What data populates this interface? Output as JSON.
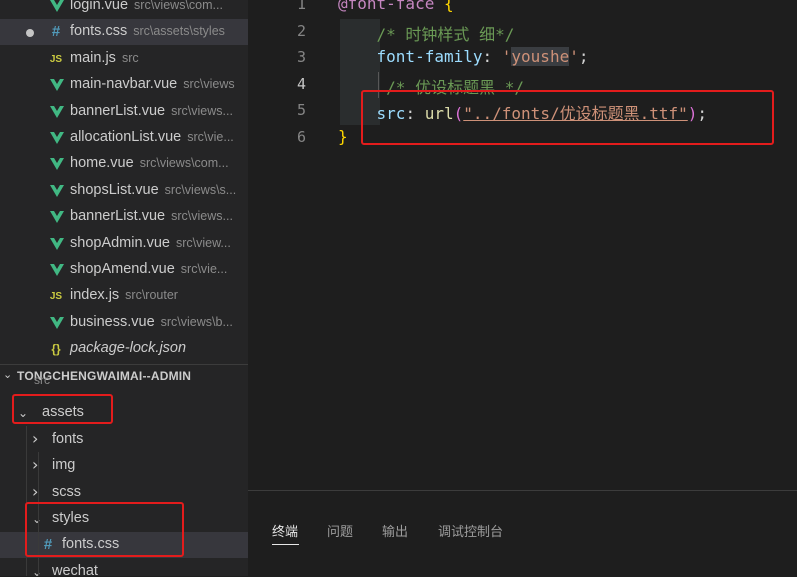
{
  "open_editors": [
    {
      "name": "login.vue",
      "path": "src\\views\\com...",
      "icon": "vue-icon",
      "active": false,
      "dirty": false
    },
    {
      "name": "fonts.css",
      "path": "src\\assets\\styles",
      "icon": "css-icon",
      "active": true,
      "dirty": true
    },
    {
      "name": "main.js",
      "path": "src",
      "icon": "js-icon",
      "active": false,
      "dirty": false
    },
    {
      "name": "main-navbar.vue",
      "path": "src\\views",
      "icon": "vue-icon",
      "active": false,
      "dirty": false
    },
    {
      "name": "bannerList.vue",
      "path": "src\\views...",
      "icon": "vue-icon",
      "active": false,
      "dirty": false
    },
    {
      "name": "allocationList.vue",
      "path": "src\\vie...",
      "icon": "vue-icon",
      "active": false,
      "dirty": false
    },
    {
      "name": "home.vue",
      "path": "src\\views\\com...",
      "icon": "vue-icon",
      "active": false,
      "dirty": false
    },
    {
      "name": "shopsList.vue",
      "path": "src\\views\\s...",
      "icon": "vue-icon",
      "active": false,
      "dirty": false
    },
    {
      "name": "bannerList.vue",
      "path": "src\\views...",
      "icon": "vue-icon",
      "active": false,
      "dirty": false
    },
    {
      "name": "shopAdmin.vue",
      "path": "src\\view...",
      "icon": "vue-icon",
      "active": false,
      "dirty": false
    },
    {
      "name": "shopAmend.vue",
      "path": "src\\vie...",
      "icon": "vue-icon",
      "active": false,
      "dirty": false
    },
    {
      "name": "index.js",
      "path": "src\\router",
      "icon": "js-icon",
      "active": false,
      "dirty": false
    },
    {
      "name": "business.vue",
      "path": "src\\views\\b...",
      "icon": "vue-icon",
      "active": false,
      "dirty": false
    },
    {
      "name": "package-lock.json",
      "path": "",
      "icon": "json-icon",
      "active": false,
      "dirty": false
    }
  ],
  "icons": {
    "js_text": "JS",
    "css_text": "#",
    "json_text": "{}"
  },
  "project": {
    "title": "TONGCHENGWAIMAI--ADMIN",
    "items": [
      {
        "label": "src",
        "chevron": "",
        "level": 0
      },
      {
        "label": "assets",
        "chevron": "open",
        "level": 1
      },
      {
        "label": "fonts",
        "chevron": "closed",
        "level": 2
      },
      {
        "label": "img",
        "chevron": "closed",
        "level": 2
      },
      {
        "label": "scss",
        "chevron": "closed",
        "level": 2
      },
      {
        "label": "styles",
        "chevron": "open",
        "level": 2
      },
      {
        "label": "fonts.css",
        "chevron": "",
        "level": 3,
        "icon": "css-icon",
        "active": true
      },
      {
        "label": "wechat",
        "chevron": "open",
        "level": 2
      }
    ]
  },
  "editor": {
    "current_line": "4",
    "lines": [
      {
        "n": "1",
        "tokens": [
          {
            "t": "@font-face",
            "c": "tok-at"
          },
          {
            "t": " ",
            "c": "tok-punc"
          },
          {
            "t": "{",
            "c": "tok-brace"
          }
        ]
      },
      {
        "n": "2",
        "tokens": [
          {
            "t": "    ",
            "c": "tok-punc"
          },
          {
            "t": "/* 时钟样式 细*/",
            "c": "tok-comment"
          }
        ]
      },
      {
        "n": "3",
        "tokens": [
          {
            "t": "    ",
            "c": "tok-punc"
          },
          {
            "t": "font-family",
            "c": "tok-prop"
          },
          {
            "t": ": ",
            "c": "tok-punc"
          },
          {
            "t": "'",
            "c": "tok-str"
          },
          {
            "t": "youshe",
            "c": "tok-str hl-word"
          },
          {
            "t": "'",
            "c": "tok-str"
          },
          {
            "t": ";",
            "c": "tok-punc"
          }
        ]
      },
      {
        "n": "4",
        "tokens": [
          {
            "t": "     ",
            "c": "tok-punc"
          },
          {
            "t": "/* 优设标题黑 */",
            "c": "tok-comment"
          }
        ]
      },
      {
        "n": "5",
        "tokens": [
          {
            "t": "    ",
            "c": "tok-punc"
          },
          {
            "t": "src",
            "c": "tok-prop"
          },
          {
            "t": ": ",
            "c": "tok-punc"
          },
          {
            "t": "url",
            "c": "tok-fn"
          },
          {
            "t": "(",
            "c": "tok-paren"
          },
          {
            "t": "\"../fonts/优设标题黑.ttf\"",
            "c": "tok-str underline"
          },
          {
            "t": ")",
            "c": "tok-paren"
          },
          {
            "t": ";",
            "c": "tok-punc"
          }
        ]
      },
      {
        "n": "6",
        "tokens": [
          {
            "t": "}",
            "c": "tok-brace"
          }
        ]
      }
    ]
  },
  "panel": {
    "tabs": [
      {
        "label": "终端",
        "active": true
      },
      {
        "label": "问题",
        "active": false
      },
      {
        "label": "输出",
        "active": false
      },
      {
        "label": "调试控制台",
        "active": false
      }
    ]
  },
  "colors": {
    "annotation_red": "#e31c1c",
    "vue_green": "#41b883",
    "css_blue": "#519aba",
    "js_yellow": "#cbcb41"
  }
}
